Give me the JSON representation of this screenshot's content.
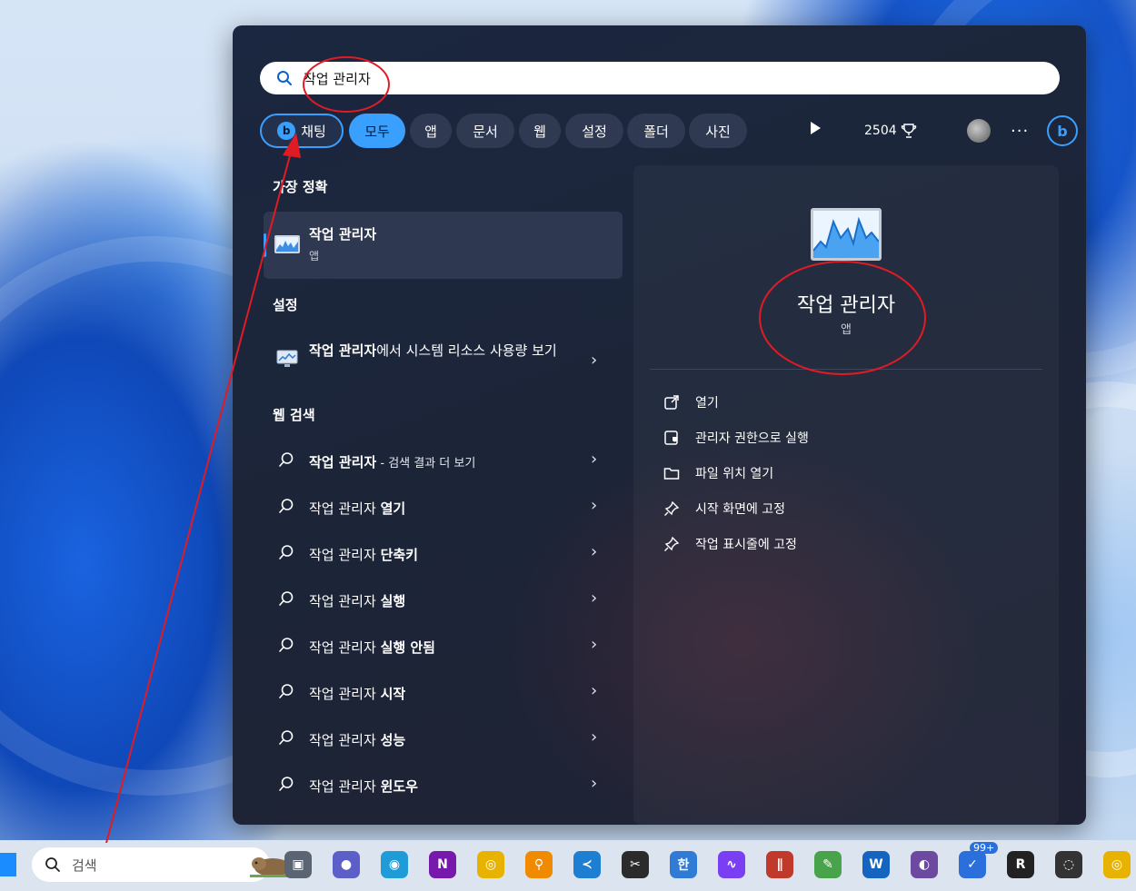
{
  "search": {
    "query": "작업 관리자"
  },
  "filters": {
    "chips": [
      "채팅",
      "모두",
      "앱",
      "문서",
      "웹",
      "설정",
      "폴더",
      "사진"
    ],
    "points": "2504",
    "more": "···"
  },
  "results": {
    "best_match_heading": "가장 정확",
    "best_match": {
      "title": "작업 관리자",
      "subtitle": "앱"
    },
    "settings_heading": "설정",
    "settings_item": {
      "bold": "작업 관리자",
      "rest": "에서 시스템 리소스 사용량 보기"
    },
    "web_heading": "웹 검색",
    "web_first": {
      "bold": "작업 관리자",
      "small": " - 검색 결과 더 보기"
    },
    "web_items": [
      {
        "base": "작업 관리자",
        "bold": "열기"
      },
      {
        "base": "작업 관리자",
        "bold": "단축키"
      },
      {
        "base": "작업 관리자",
        "bold": "실행"
      },
      {
        "base": "작업 관리자",
        "bold": "실행 안됨"
      },
      {
        "base": "작업 관리자",
        "bold": "시작"
      },
      {
        "base": "작업 관리자",
        "bold": "성능"
      },
      {
        "base": "작업 관리자",
        "bold": "윈도우"
      }
    ]
  },
  "detail": {
    "title": "작업 관리자",
    "subtitle": "앱",
    "actions": [
      "열기",
      "관리자 권한으로 실행",
      "파일 위치 열기",
      "시작 화면에 고정",
      "작업 표시줄에 고정"
    ]
  },
  "taskbar": {
    "search_label": "검색",
    "badge": "99+",
    "apps": [
      "task-view",
      "teams-meet",
      "edge",
      "onenote",
      "chrome",
      "search-app",
      "vscode",
      "snip",
      "hangul",
      "wave",
      "stripes",
      "notepad-plus",
      "word-circle",
      "vlc-like",
      "todo",
      "r-studio",
      "obs",
      "chrome-2"
    ]
  },
  "colors": {
    "accent": "#3aa0ff",
    "annotation": "#e01b24",
    "panel": "#1c2538"
  }
}
